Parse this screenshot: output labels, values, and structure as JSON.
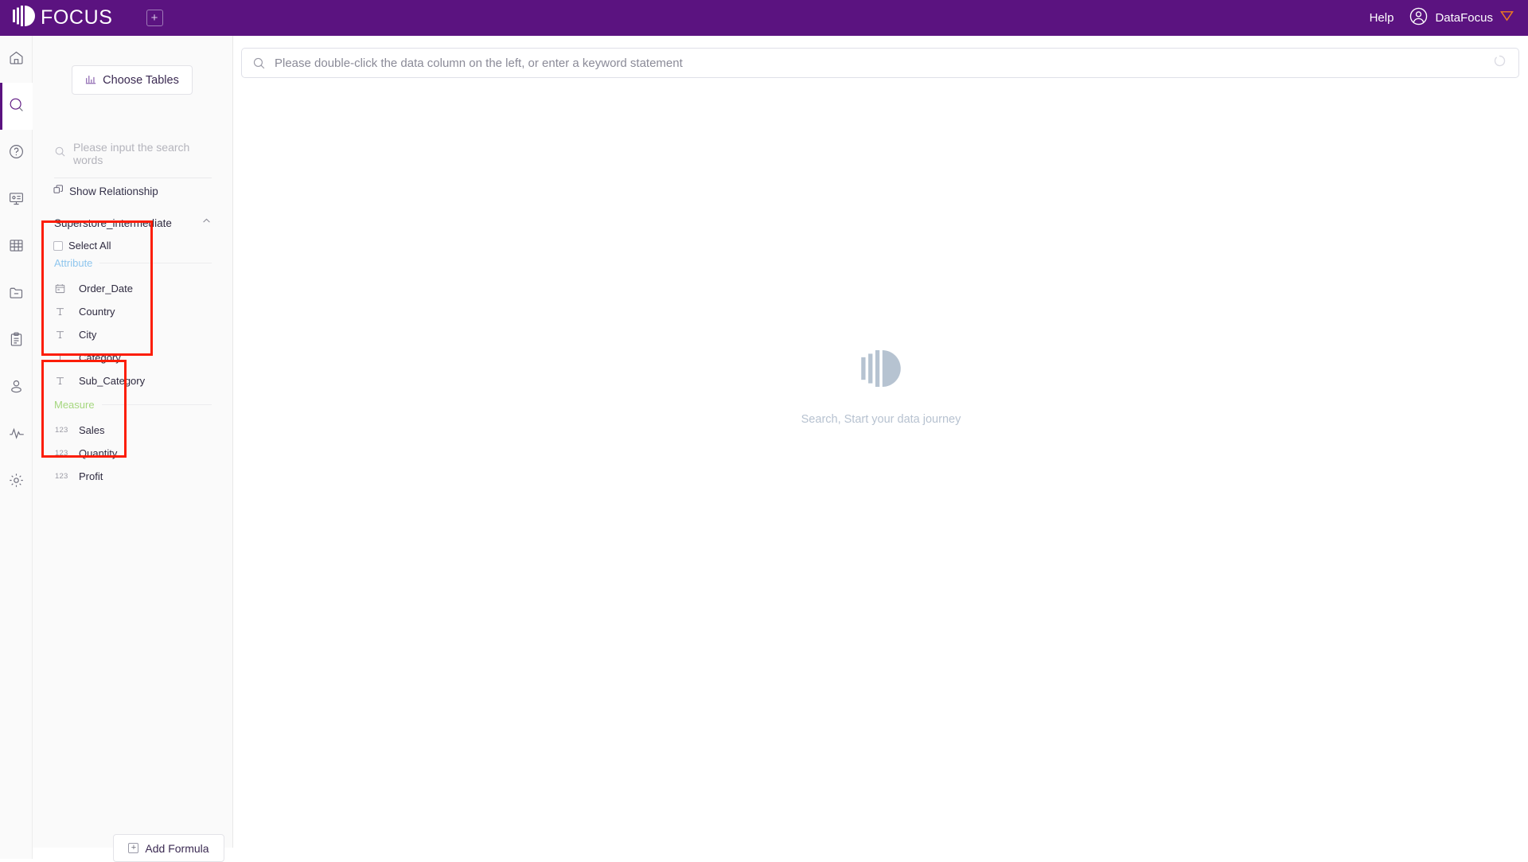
{
  "header": {
    "brand": "FOCUS",
    "brand_logo_icon": "focus-logo-icon",
    "add_tab_icon": "plus-square-icon",
    "help_label": "Help",
    "user_icon": "user-circle-icon",
    "user_name": "DataFocus",
    "user_badge_icon": "shield-icon",
    "bg_color": "#5b1380"
  },
  "rail": {
    "items": [
      {
        "name": "home-icon",
        "active": false
      },
      {
        "name": "search-icon",
        "active": true
      },
      {
        "name": "question-circle-icon",
        "active": false
      },
      {
        "name": "presentation-icon",
        "active": false
      },
      {
        "name": "table-grid-icon",
        "active": false
      },
      {
        "name": "folder-minus-icon",
        "active": false
      },
      {
        "name": "clipboard-icon",
        "active": false
      },
      {
        "name": "user-icon",
        "active": false
      },
      {
        "name": "pulse-icon",
        "active": false
      },
      {
        "name": "settings-gear-icon",
        "active": false
      }
    ],
    "active_indicator_color": "#5b1380"
  },
  "panel": {
    "choose_tables_label": "Choose Tables",
    "choose_tables_icon": "bar-chart-icon",
    "search_placeholder": "Please input the search words",
    "search_icon": "search-icon",
    "show_relationship_label": "Show Relationship",
    "show_relationship_icon": "relationship-icon",
    "table_name": "Superstore_intermediate",
    "collapse_icon": "chevron-up-icon",
    "select_all_label": "Select All",
    "groups": [
      {
        "label": "Attribute",
        "color": "#8fc6ee",
        "fields": [
          {
            "label": "Order_Date",
            "icon": "calendar-icon",
            "icon_text": ""
          },
          {
            "label": "Country",
            "icon": "text-type-icon",
            "icon_text": "T"
          },
          {
            "label": "City",
            "icon": "text-type-icon",
            "icon_text": "T"
          },
          {
            "label": "Category",
            "icon": "text-type-icon",
            "icon_text": "T"
          },
          {
            "label": "Sub_Category",
            "icon": "text-type-icon",
            "icon_text": "T"
          }
        ]
      },
      {
        "label": "Measure",
        "color": "#a5d77f",
        "fields": [
          {
            "label": "Sales",
            "icon": "number-type-icon",
            "icon_text": "123"
          },
          {
            "label": "Quantity",
            "icon": "number-type-icon",
            "icon_text": "123"
          },
          {
            "label": "Profit",
            "icon": "number-type-icon",
            "icon_text": "123"
          }
        ]
      }
    ],
    "add_formula_label": "Add Formula",
    "add_formula_icon": "plus-square-icon",
    "annotation_color": "#fc1d06"
  },
  "main": {
    "search_placeholder": "Please double-click the data column on the left, or enter a keyword statement",
    "search_icon": "search-icon",
    "loading_icon": "spinner-icon",
    "empty_logo_icon": "focus-logo-icon",
    "empty_text": "Search, Start your data journey"
  }
}
